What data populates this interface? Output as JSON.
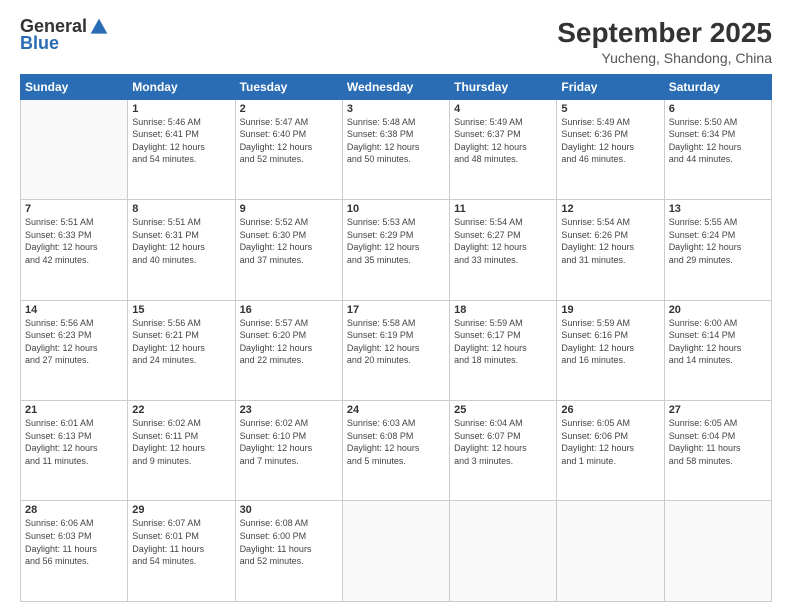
{
  "logo": {
    "general": "General",
    "blue": "Blue"
  },
  "title": "September 2025",
  "location": "Yucheng, Shandong, China",
  "headers": [
    "Sunday",
    "Monday",
    "Tuesday",
    "Wednesday",
    "Thursday",
    "Friday",
    "Saturday"
  ],
  "weeks": [
    [
      {
        "day": "",
        "info": ""
      },
      {
        "day": "1",
        "info": "Sunrise: 5:46 AM\nSunset: 6:41 PM\nDaylight: 12 hours\nand 54 minutes."
      },
      {
        "day": "2",
        "info": "Sunrise: 5:47 AM\nSunset: 6:40 PM\nDaylight: 12 hours\nand 52 minutes."
      },
      {
        "day": "3",
        "info": "Sunrise: 5:48 AM\nSunset: 6:38 PM\nDaylight: 12 hours\nand 50 minutes."
      },
      {
        "day": "4",
        "info": "Sunrise: 5:49 AM\nSunset: 6:37 PM\nDaylight: 12 hours\nand 48 minutes."
      },
      {
        "day": "5",
        "info": "Sunrise: 5:49 AM\nSunset: 6:36 PM\nDaylight: 12 hours\nand 46 minutes."
      },
      {
        "day": "6",
        "info": "Sunrise: 5:50 AM\nSunset: 6:34 PM\nDaylight: 12 hours\nand 44 minutes."
      }
    ],
    [
      {
        "day": "7",
        "info": "Sunrise: 5:51 AM\nSunset: 6:33 PM\nDaylight: 12 hours\nand 42 minutes."
      },
      {
        "day": "8",
        "info": "Sunrise: 5:51 AM\nSunset: 6:31 PM\nDaylight: 12 hours\nand 40 minutes."
      },
      {
        "day": "9",
        "info": "Sunrise: 5:52 AM\nSunset: 6:30 PM\nDaylight: 12 hours\nand 37 minutes."
      },
      {
        "day": "10",
        "info": "Sunrise: 5:53 AM\nSunset: 6:29 PM\nDaylight: 12 hours\nand 35 minutes."
      },
      {
        "day": "11",
        "info": "Sunrise: 5:54 AM\nSunset: 6:27 PM\nDaylight: 12 hours\nand 33 minutes."
      },
      {
        "day": "12",
        "info": "Sunrise: 5:54 AM\nSunset: 6:26 PM\nDaylight: 12 hours\nand 31 minutes."
      },
      {
        "day": "13",
        "info": "Sunrise: 5:55 AM\nSunset: 6:24 PM\nDaylight: 12 hours\nand 29 minutes."
      }
    ],
    [
      {
        "day": "14",
        "info": "Sunrise: 5:56 AM\nSunset: 6:23 PM\nDaylight: 12 hours\nand 27 minutes."
      },
      {
        "day": "15",
        "info": "Sunrise: 5:56 AM\nSunset: 6:21 PM\nDaylight: 12 hours\nand 24 minutes."
      },
      {
        "day": "16",
        "info": "Sunrise: 5:57 AM\nSunset: 6:20 PM\nDaylight: 12 hours\nand 22 minutes."
      },
      {
        "day": "17",
        "info": "Sunrise: 5:58 AM\nSunset: 6:19 PM\nDaylight: 12 hours\nand 20 minutes."
      },
      {
        "day": "18",
        "info": "Sunrise: 5:59 AM\nSunset: 6:17 PM\nDaylight: 12 hours\nand 18 minutes."
      },
      {
        "day": "19",
        "info": "Sunrise: 5:59 AM\nSunset: 6:16 PM\nDaylight: 12 hours\nand 16 minutes."
      },
      {
        "day": "20",
        "info": "Sunrise: 6:00 AM\nSunset: 6:14 PM\nDaylight: 12 hours\nand 14 minutes."
      }
    ],
    [
      {
        "day": "21",
        "info": "Sunrise: 6:01 AM\nSunset: 6:13 PM\nDaylight: 12 hours\nand 11 minutes."
      },
      {
        "day": "22",
        "info": "Sunrise: 6:02 AM\nSunset: 6:11 PM\nDaylight: 12 hours\nand 9 minutes."
      },
      {
        "day": "23",
        "info": "Sunrise: 6:02 AM\nSunset: 6:10 PM\nDaylight: 12 hours\nand 7 minutes."
      },
      {
        "day": "24",
        "info": "Sunrise: 6:03 AM\nSunset: 6:08 PM\nDaylight: 12 hours\nand 5 minutes."
      },
      {
        "day": "25",
        "info": "Sunrise: 6:04 AM\nSunset: 6:07 PM\nDaylight: 12 hours\nand 3 minutes."
      },
      {
        "day": "26",
        "info": "Sunrise: 6:05 AM\nSunset: 6:06 PM\nDaylight: 12 hours\nand 1 minute."
      },
      {
        "day": "27",
        "info": "Sunrise: 6:05 AM\nSunset: 6:04 PM\nDaylight: 11 hours\nand 58 minutes."
      }
    ],
    [
      {
        "day": "28",
        "info": "Sunrise: 6:06 AM\nSunset: 6:03 PM\nDaylight: 11 hours\nand 56 minutes."
      },
      {
        "day": "29",
        "info": "Sunrise: 6:07 AM\nSunset: 6:01 PM\nDaylight: 11 hours\nand 54 minutes."
      },
      {
        "day": "30",
        "info": "Sunrise: 6:08 AM\nSunset: 6:00 PM\nDaylight: 11 hours\nand 52 minutes."
      },
      {
        "day": "",
        "info": ""
      },
      {
        "day": "",
        "info": ""
      },
      {
        "day": "",
        "info": ""
      },
      {
        "day": "",
        "info": ""
      }
    ]
  ]
}
